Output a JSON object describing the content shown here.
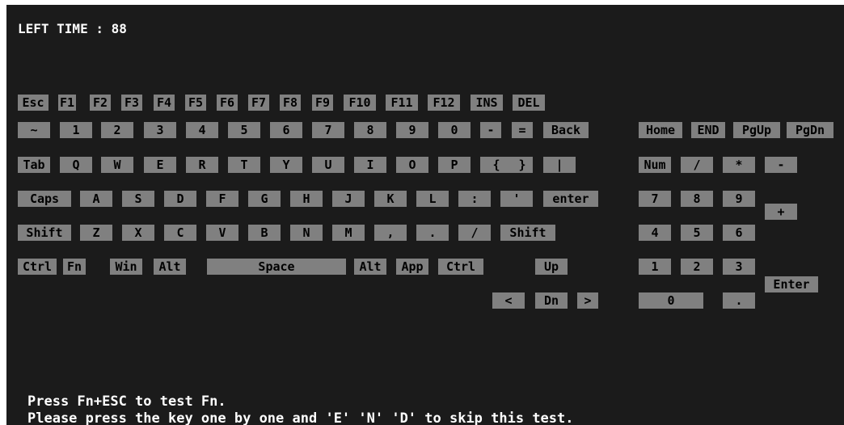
{
  "timer": {
    "label": "LEFT TIME",
    "separator": ":",
    "value": "88"
  },
  "keys": {
    "esc": "Esc",
    "f1": "F1",
    "f2": "F2",
    "f3": "F3",
    "f4": "F4",
    "f5": "F5",
    "f6": "F6",
    "f7": "F7",
    "f8": "F8",
    "f9": "F9",
    "f10": "F10",
    "f11": "F11",
    "f12": "F12",
    "ins": "INS",
    "del": "DEL",
    "tilde": "~",
    "n1": "1",
    "n2": "2",
    "n3": "3",
    "n4": "4",
    "n5": "5",
    "n6": "6",
    "n7": "7",
    "n8": "8",
    "n9": "9",
    "n0": "0",
    "minus": "-",
    "equals": "=",
    "back": "Back",
    "home": "Home",
    "end": "END",
    "pgup": "PgUp",
    "pgdn": "PgDn",
    "tab": "Tab",
    "q": "Q",
    "w": "W",
    "e": "E",
    "r": "R",
    "t": "T",
    "y": "Y",
    "u": "U",
    "i": "I",
    "o": "O",
    "p": "P",
    "lbrace": "{",
    "rbrace": "}",
    "pipe": "|",
    "num": "Num",
    "kp_slash": "/",
    "kp_star": "*",
    "kp_minus": "-",
    "caps": "Caps",
    "a": "A",
    "s": "S",
    "d": "D",
    "f": "F",
    "g": "G",
    "h": "H",
    "j": "J",
    "k": "K",
    "l": "L",
    "colon": ":",
    "quote": "'",
    "enter": "enter",
    "kp7": "7",
    "kp8": "8",
    "kp9": "9",
    "kp_plus": "+",
    "lshift": "Shift",
    "z": "Z",
    "x": "X",
    "c": "C",
    "v": "V",
    "b": "B",
    "n": "N",
    "m": "M",
    "comma": ",",
    "period": ".",
    "slash": "/",
    "rshift": "Shift",
    "kp4": "4",
    "kp5": "5",
    "kp6": "6",
    "lctrl": "Ctrl",
    "fn": "Fn",
    "win": "Win",
    "lalt": "Alt",
    "space": "Space",
    "ralt": "Alt",
    "app": "App",
    "rctrl": "Ctrl",
    "up": "Up",
    "kp1": "1",
    "kp2": "2",
    "kp3": "3",
    "kp_enter": "Enter",
    "left": "<",
    "down": "Dn",
    "right": ">",
    "kp0": "0",
    "kp_dot": "."
  },
  "instructions": {
    "line1": "Press Fn+ESC to test Fn.",
    "line2": "Please press the key one by one and 'E' 'N' 'D' to skip this test."
  },
  "colors": {
    "screen_bg": "#1b1b1b",
    "key_bg": "#808080",
    "key_text": "#000000",
    "text": "#ffffff"
  }
}
